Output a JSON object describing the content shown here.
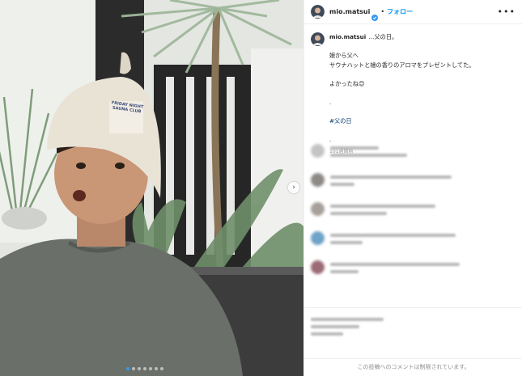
{
  "post": {
    "username": "mio.matsui",
    "separator": "•",
    "follow_label": "フォロー",
    "more_icon": "•••",
    "next_icon": "›"
  },
  "caption": {
    "username": "mio.matsui",
    "title": "…父の日。",
    "line1": "娘から父へ",
    "line2": "サウナハットと檜の香りのアロマをプレゼントしてた。",
    "line3": "よかったね😊",
    "dot1": ".",
    "hashtag": "#父の日",
    "dot2": ".",
    "timestamp": "101週間前"
  },
  "photo": {
    "hat_text": "FRIDAY NIGHT SAUNA CLUB"
  },
  "carousel": {
    "count": 7,
    "active_index": 0
  },
  "footer": {
    "notice": "この投稿へのコメントは制限されています。"
  },
  "colors": {
    "link": "#0095f6",
    "hashtag": "#00376b",
    "verified": "#3897f0"
  }
}
